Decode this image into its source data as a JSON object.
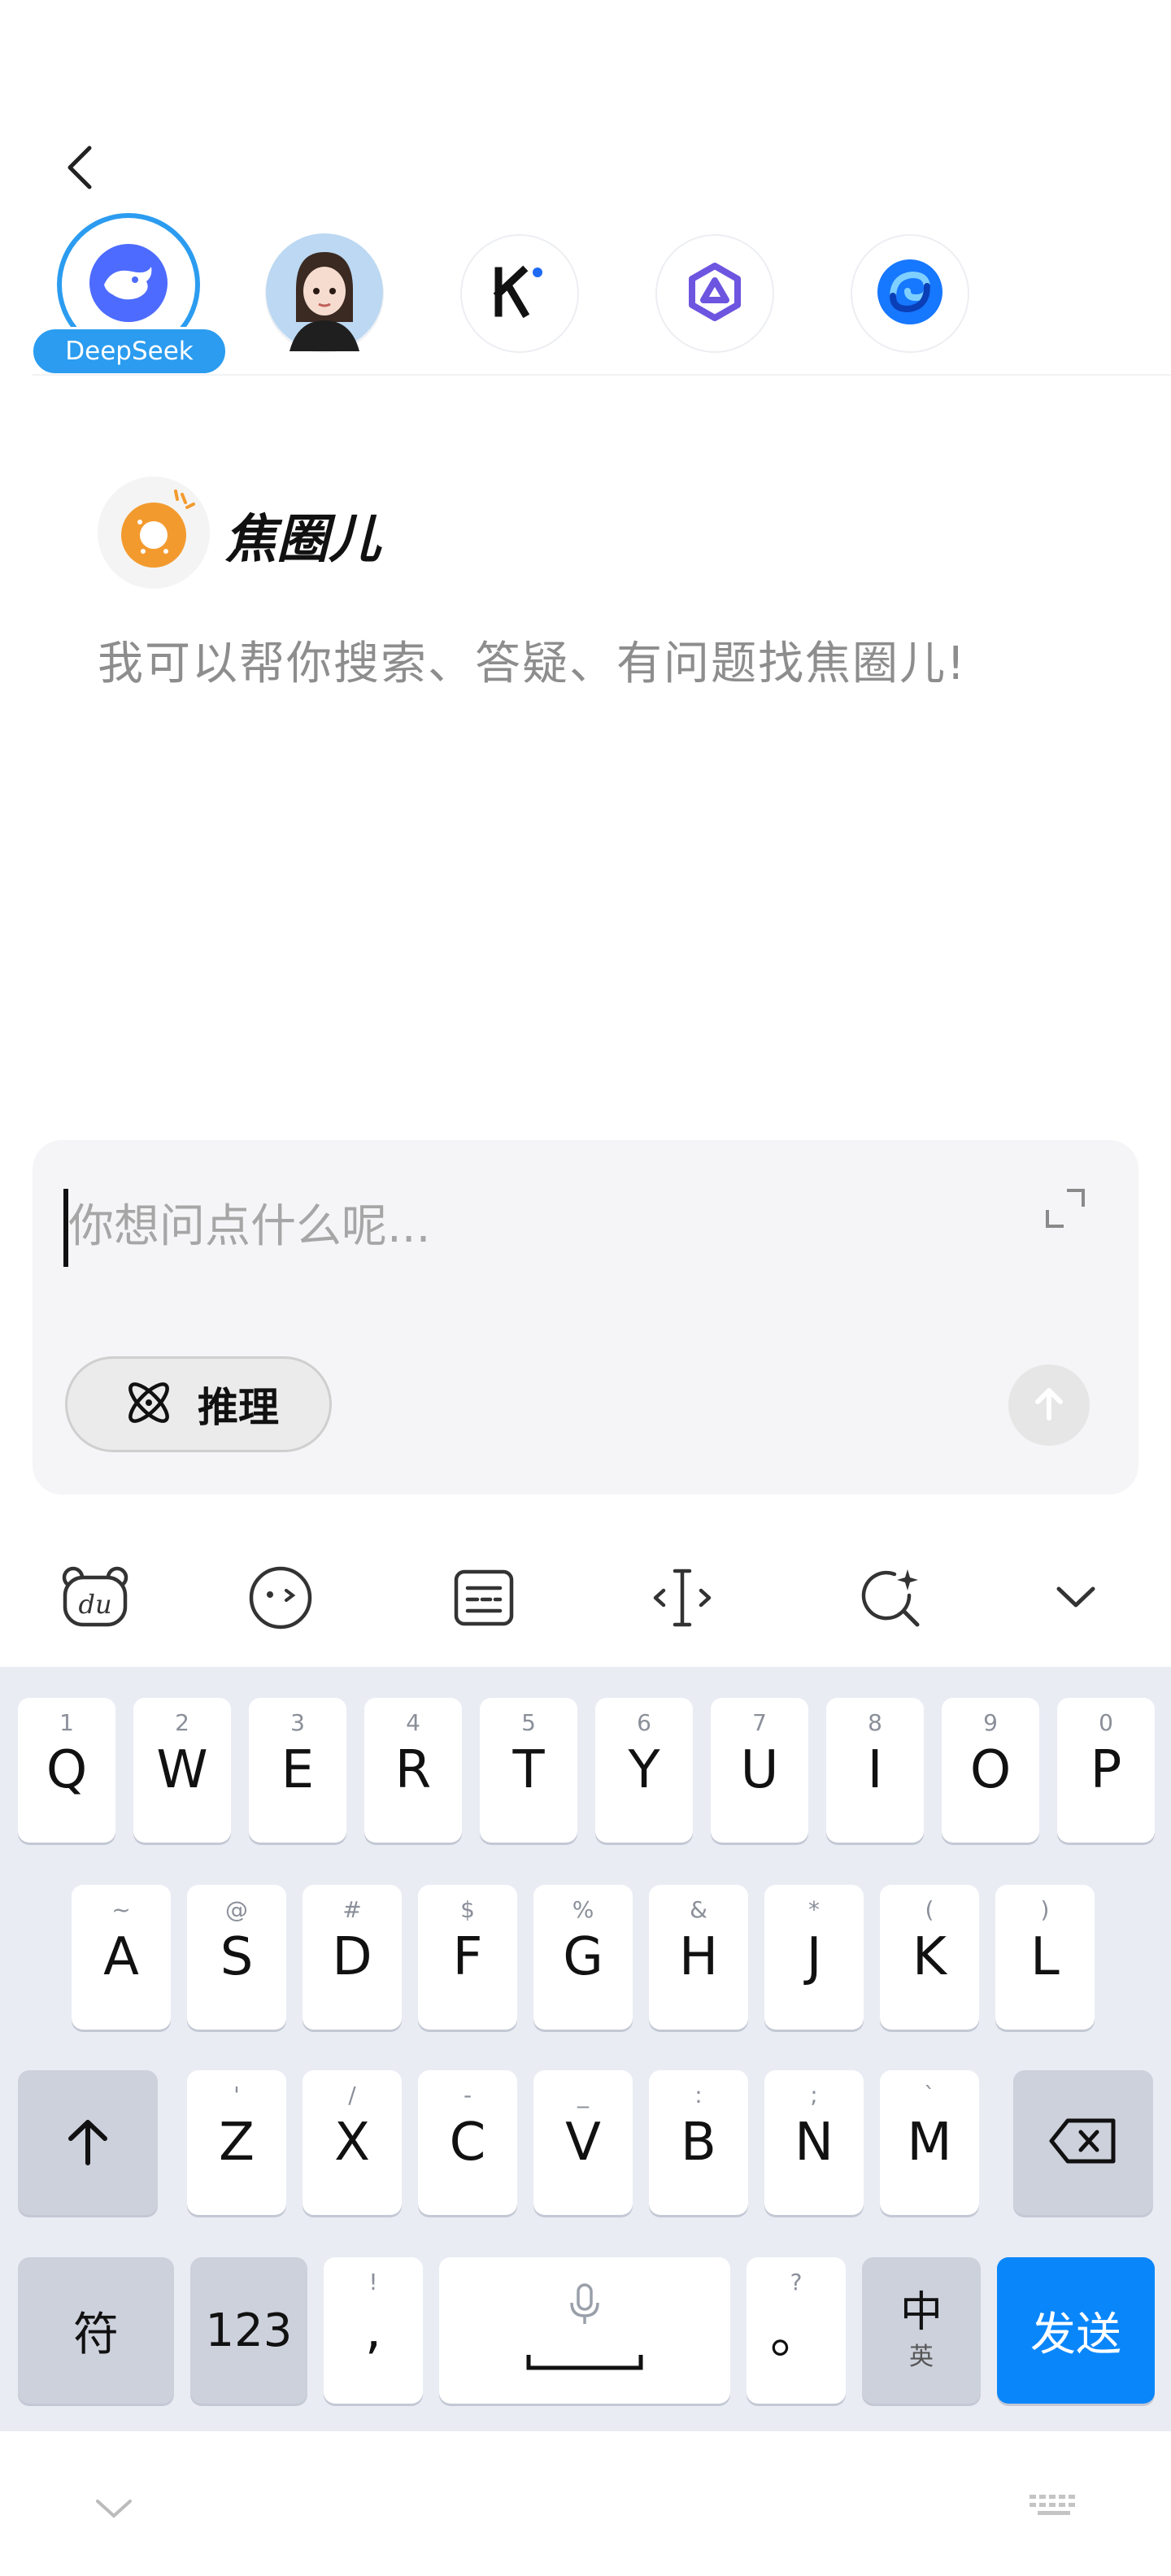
{
  "header": {
    "back_icon": "chevron-left-icon"
  },
  "bots": [
    {
      "name": "DeepSeek",
      "icon": "whale-icon",
      "active": true
    },
    {
      "name": "avatar-girl",
      "icon": "avatar-icon"
    },
    {
      "name": "kimi",
      "icon": "k-logo-icon"
    },
    {
      "name": "qwen",
      "icon": "hexagon-logo-icon"
    },
    {
      "name": "doubao",
      "icon": "swirl-logo-icon"
    }
  ],
  "active_badge": "DeepSeek",
  "assistant": {
    "name": "焦圈儿",
    "description": "我可以帮你搜索、答疑、有问题找焦圈儿!"
  },
  "input": {
    "placeholder": "你想问点什么呢...",
    "value": "",
    "reason_button": "推理"
  },
  "toolbar": [
    "du-bear-icon",
    "emoji-icon",
    "clipboard-icon",
    "cursor-move-icon",
    "search-sparkle-icon",
    "collapse-chevron-icon"
  ],
  "keyboard": {
    "row1": [
      {
        "k": "Q",
        "s": "1"
      },
      {
        "k": "W",
        "s": "2"
      },
      {
        "k": "E",
        "s": "3"
      },
      {
        "k": "R",
        "s": "4"
      },
      {
        "k": "T",
        "s": "5"
      },
      {
        "k": "Y",
        "s": "6"
      },
      {
        "k": "U",
        "s": "7"
      },
      {
        "k": "I",
        "s": "8"
      },
      {
        "k": "O",
        "s": "9"
      },
      {
        "k": "P",
        "s": "0"
      }
    ],
    "row2": [
      {
        "k": "A",
        "s": "~"
      },
      {
        "k": "S",
        "s": "@"
      },
      {
        "k": "D",
        "s": "#"
      },
      {
        "k": "F",
        "s": "$"
      },
      {
        "k": "G",
        "s": "%"
      },
      {
        "k": "H",
        "s": "&"
      },
      {
        "k": "J",
        "s": "*"
      },
      {
        "k": "K",
        "s": "("
      },
      {
        "k": "L",
        "s": ")"
      }
    ],
    "row3": [
      {
        "k": "Z",
        "s": "'"
      },
      {
        "k": "X",
        "s": "/"
      },
      {
        "k": "C",
        "s": "-"
      },
      {
        "k": "V",
        "s": "_"
      },
      {
        "k": "B",
        "s": ":"
      },
      {
        "k": "N",
        "s": ";"
      },
      {
        "k": "M",
        "s": "`"
      }
    ],
    "symbol_key": "符",
    "num_key": "123",
    "comma_key": {
      "k": ",",
      "s": "!"
    },
    "period_key": {
      "k": "。",
      "s": "?"
    },
    "lang_key": {
      "k": "中",
      "s": "英"
    },
    "send_key": "发送"
  }
}
